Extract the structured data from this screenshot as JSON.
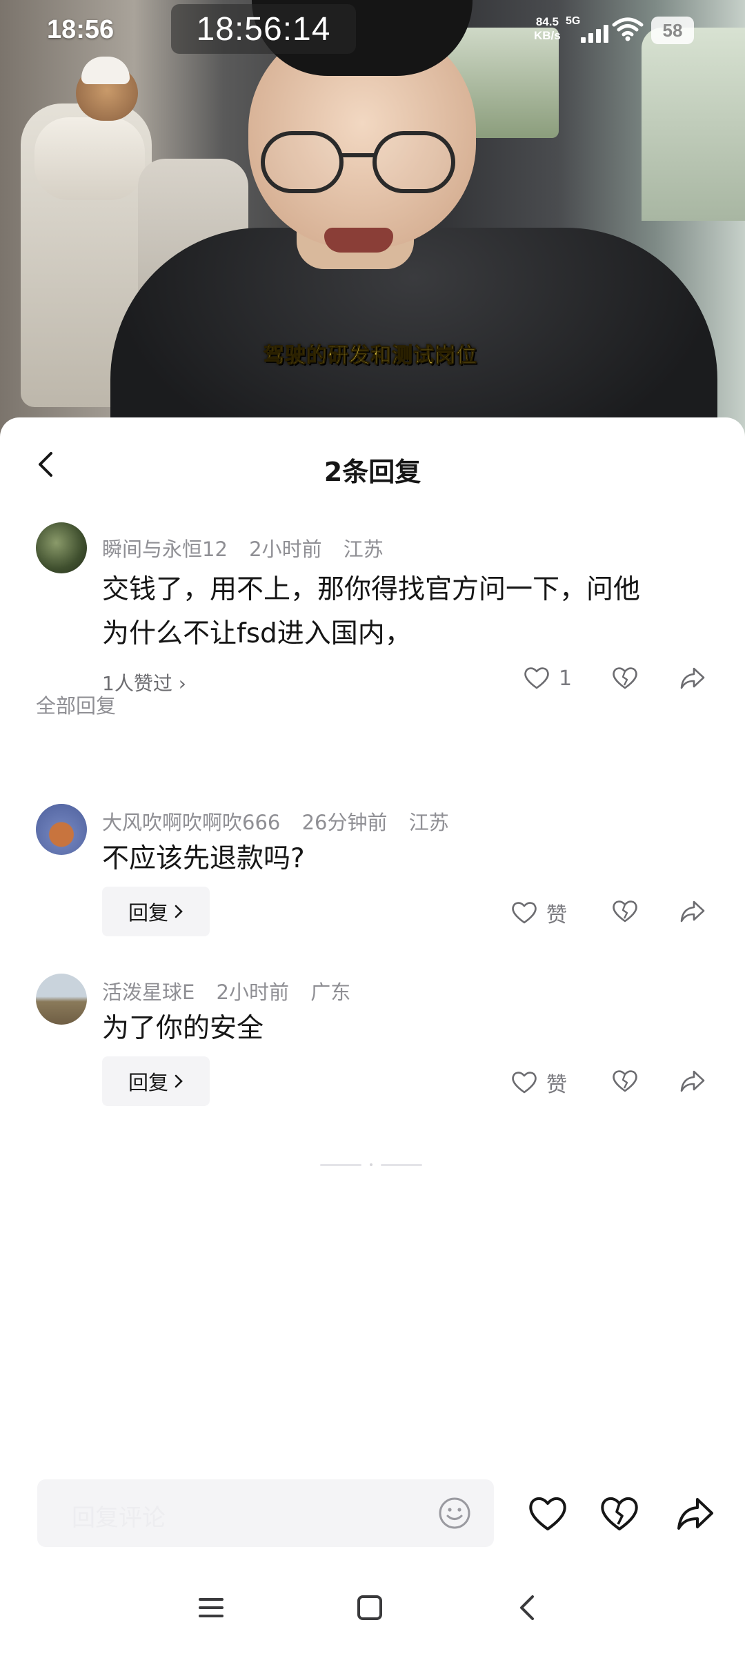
{
  "status_bar": {
    "time": "18:56",
    "clock_overlay": "18:56:14",
    "net_speed_value": "84.5",
    "net_speed_unit": "KB/s",
    "network_type": "5G",
    "battery": "58"
  },
  "video": {
    "subtitle": "驾驶的研发和测试岗位"
  },
  "sheet": {
    "title": "2条回复",
    "back_icon": "chevron-left-icon"
  },
  "main_comment": {
    "username": "瞬间与永恒12",
    "time": "2小时前",
    "location": "江苏",
    "text_line1": "交钱了，用不上，那你得找官方问一下，问他",
    "text_line2": "为什么不让fsd进入国内，",
    "liked_by": "1人赞过 ›",
    "like_count": "1"
  },
  "section_label": "全部回复",
  "replies": [
    {
      "username": "大风吹啊吹啊吹666",
      "time": "26分钟前",
      "location": "江苏",
      "text": "不应该先退款吗?",
      "reply_label": "回复",
      "like_label": "赞"
    },
    {
      "username": "活泼星球E",
      "time": "2小时前",
      "location": "广东",
      "text": "为了你的安全",
      "reply_label": "回复",
      "like_label": "赞"
    }
  ],
  "bottom_bar": {
    "input_placeholder": "回复评论",
    "emoji_icon": "smiley-icon"
  },
  "colors": {
    "subtitle_yellow": "#ffe04a",
    "meta_gray": "#8f8f94",
    "pill_bg": "#f4f4f6"
  }
}
